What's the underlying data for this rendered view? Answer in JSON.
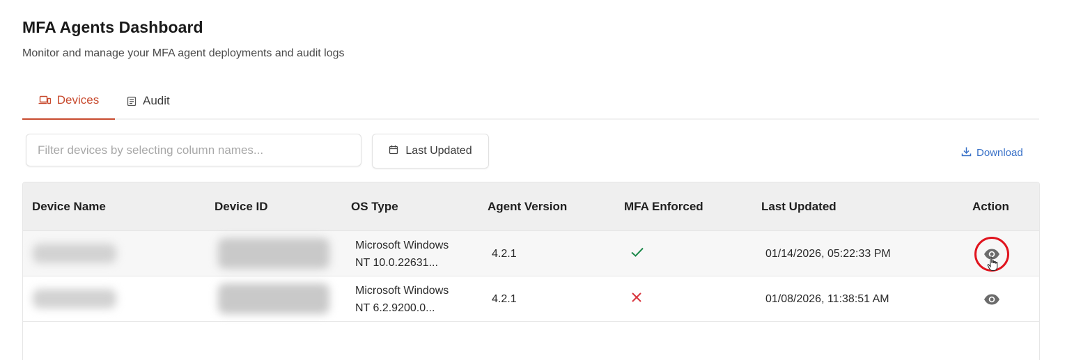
{
  "header": {
    "title": "MFA Agents Dashboard",
    "subtitle": "Monitor and manage your MFA agent deployments and audit logs"
  },
  "tabs": [
    {
      "label": "Devices",
      "icon": "laptop-icon",
      "active": true
    },
    {
      "label": "Audit",
      "icon": "document-icon",
      "active": false
    }
  ],
  "toolbar": {
    "filter_placeholder": "Filter devices by selecting column names...",
    "date_button_label": "Last Updated",
    "download_label": "Download"
  },
  "table": {
    "columns": [
      "Device Name",
      "Device ID",
      "OS Type",
      "Agent Version",
      "MFA Enforced",
      "Last Updated",
      "Action"
    ],
    "rows": [
      {
        "device_name": "",
        "device_id": "",
        "os_line1": "Microsoft Windows",
        "os_line2": "NT 10.0.22631...",
        "agent_version": "4.2.1",
        "mfa_enforced": true,
        "last_updated": "01/14/2026, 05:22:33 PM"
      },
      {
        "device_name": "",
        "device_id": "",
        "os_line1": "Microsoft Windows",
        "os_line2": "NT 6.2.9200.0...",
        "agent_version": "4.2.1",
        "mfa_enforced": false,
        "last_updated": "01/08/2026, 11:38:51 AM"
      }
    ]
  },
  "colors": {
    "accent": "#c84a2e",
    "link": "#3a72c8",
    "check": "#1e8a4c",
    "cross": "#d9363e",
    "highlight": "#e0141e"
  }
}
